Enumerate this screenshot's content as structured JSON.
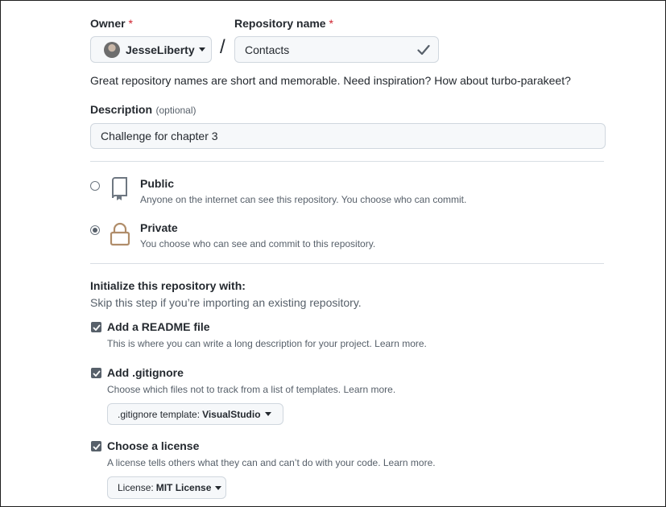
{
  "owner": {
    "label": "Owner",
    "required_mark": "*",
    "name": "JesseLiberty"
  },
  "repo_name": {
    "label": "Repository name",
    "required_mark": "*",
    "value": "Contacts"
  },
  "slash": "/",
  "name_hint": "Great repository names are short and memorable. Need inspiration? How about turbo-parakeet?",
  "description": {
    "label": "Description",
    "optional": "(optional)",
    "value": "Challenge for chapter 3"
  },
  "visibility": {
    "options": [
      {
        "title": "Public",
        "desc": "Anyone on the internet can see this repository. You choose who can commit.",
        "selected": false
      },
      {
        "title": "Private",
        "desc": "You choose who can see and commit to this repository.",
        "selected": true
      }
    ]
  },
  "init": {
    "heading": "Initialize this repository with:",
    "subheading": "Skip this step if you’re importing an existing repository.",
    "readme": {
      "label": "Add a README file",
      "desc": "This is where you can write a long description for your project.",
      "link": "Learn more.",
      "checked": true
    },
    "gitignore": {
      "label": "Add .gitignore",
      "desc": "Choose which files not to track from a list of templates.",
      "link": "Learn more.",
      "checked": true,
      "select_prefix": ".gitignore template:",
      "select_value": "VisualStudio"
    },
    "license": {
      "label": "Choose a license",
      "desc": "A license tells others what they can and can’t do with your code.",
      "link": "Learn more.",
      "checked": true,
      "select_prefix": "License:",
      "select_value": "MIT License"
    }
  },
  "colors": {
    "required": "#cf222e",
    "text": "#24292f",
    "muted": "#57606a",
    "border": "#d0d7de",
    "field_bg": "#f6f8fa"
  }
}
